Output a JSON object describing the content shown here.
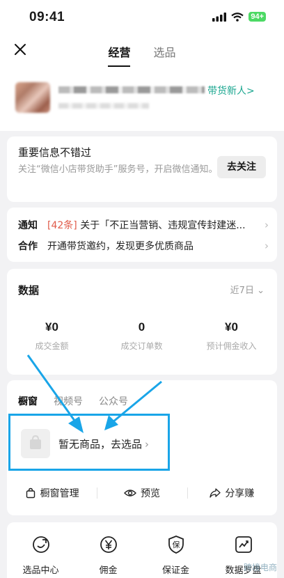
{
  "status_bar": {
    "time": "09:41",
    "battery": "94+"
  },
  "nav": {
    "tabs": [
      "经营",
      "选品"
    ]
  },
  "profile": {
    "badge": "带货新人>"
  },
  "follow_card": {
    "title": "重要信息不错过",
    "desc": "关注“微信小店带货助手”服务号，开启微信通知。",
    "button": "去关注"
  },
  "notices": {
    "notice_label": "通知",
    "notice_count": "[42条]",
    "notice_text": " 关于「不正当营销、违规宣传封建迷...",
    "coop_label": "合作",
    "coop_text": "开通带货邀约，发现更多优质商品"
  },
  "data_card": {
    "title": "数据",
    "period": "近7日",
    "metrics": [
      {
        "value": "¥0",
        "label": "成交金额"
      },
      {
        "value": "0",
        "label": "成交订单数"
      },
      {
        "value": "¥0",
        "label": "预计佣金收入"
      }
    ]
  },
  "window_card": {
    "tabs": [
      "橱窗",
      "视频号",
      "公众号"
    ],
    "empty_text": "暂无商品，去选品",
    "actions": [
      "橱窗管理",
      "预览",
      "分享赚"
    ]
  },
  "bottom": {
    "items": [
      "选品中心",
      "佣金",
      "保证金",
      "数据罗盘"
    ]
  },
  "watermark": "跨境电商",
  "colors": {
    "accent_green": "#1aa68f",
    "annotation_blue": "#19a5e8",
    "count_red": "#e05b4a"
  }
}
